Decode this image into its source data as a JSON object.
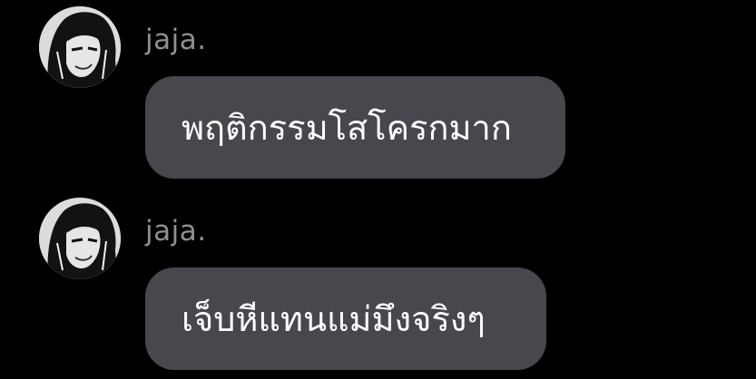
{
  "messages": [
    {
      "sender": "jaja.",
      "text": "พฤติกรรมโสโครกมาก",
      "avatar_icon": "anime-profile-avatar-icon"
    },
    {
      "sender": "jaja.",
      "text": "เจ็บหีแทนแม่มึงจริงๆ",
      "avatar_icon": "anime-profile-avatar-icon"
    }
  ],
  "colors": {
    "background": "#000000",
    "bubble": "#46484e",
    "sender_name": "#8e8e93",
    "message_text": "#ffffff"
  }
}
